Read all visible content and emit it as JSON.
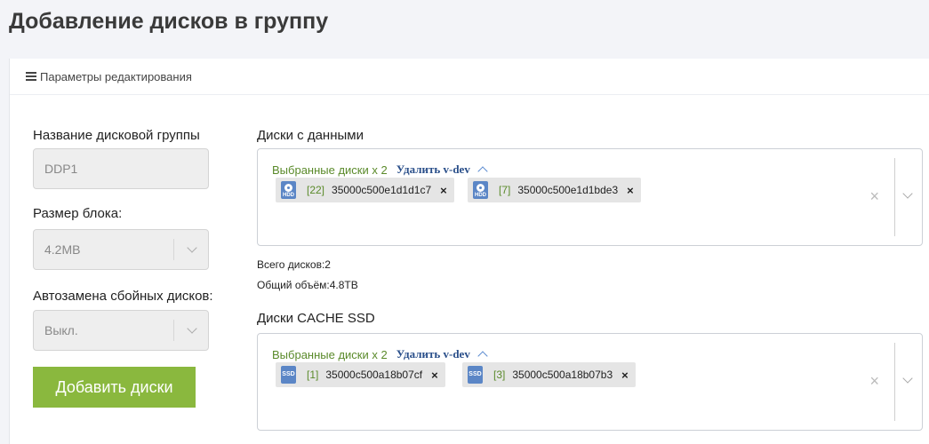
{
  "page": {
    "title": "Добавление дисков в группу"
  },
  "panel": {
    "header": "Параметры редактирования"
  },
  "left": {
    "group_name_label": "Название дисковой группы",
    "group_name_value": "DDP1",
    "block_size_label": "Размер блока:",
    "block_size_value": "4.2MB",
    "autoreplace_label": "Автозамена сбойных дисков:",
    "autoreplace_value": "Выкл.",
    "add_button": "Добавить диски"
  },
  "data_disks": {
    "label": "Диски с данными",
    "selected": "Выбранные диски x 2",
    "delete_vdev": "Удалить v-dev",
    "chips": [
      {
        "type": "HDD",
        "index": "[22]",
        "id": "35000c500e1d1d1c7"
      },
      {
        "type": "HDD",
        "index": "[7]",
        "id": "35000c500e1d1bde3"
      }
    ],
    "total_disks": "Всего дисков:2",
    "total_volume": "Общий объём:4.8TB"
  },
  "cache_disks": {
    "label": "Диски CACHE SSD",
    "selected": "Выбранные диски x 2",
    "delete_vdev": "Удалить v-dev",
    "chips": [
      {
        "type": "SSD",
        "index": "[1]",
        "id": "35000c500a18b07cf"
      },
      {
        "type": "SSD",
        "index": "[3]",
        "id": "35000c500a18b07b3"
      }
    ]
  },
  "icons": {
    "chip_x": "×",
    "clear": "×"
  },
  "colors": {
    "accent_green": "#8ab83e",
    "index_green": "#5a8a2a",
    "link_blue": "#2a4f8a",
    "disk_icon_blue": "#5b86c6"
  }
}
